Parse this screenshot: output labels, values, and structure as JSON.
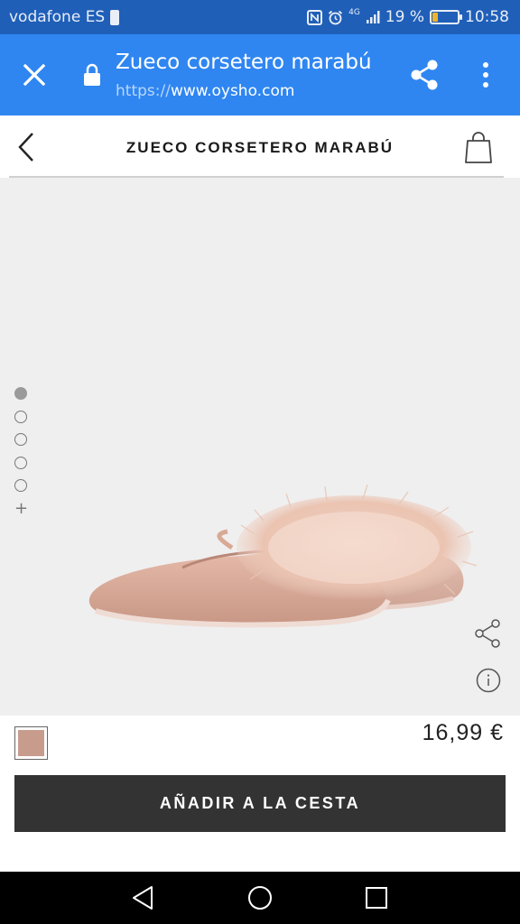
{
  "status_bar": {
    "carrier": "vodafone ES",
    "network_type": "4G",
    "battery_percent": "19 %",
    "battery_level": 0.19,
    "time": "10:58",
    "icons": [
      "sim-icon",
      "nfc-icon",
      "alarm-icon",
      "signal-icon",
      "battery-icon"
    ]
  },
  "browser": {
    "title": "Zueco corsetero marabú",
    "url_scheme": "https://",
    "url_host": "www.oysho.com",
    "accent_color": "#2f86f1",
    "icons": [
      "close-icon",
      "lock-icon",
      "share-icon",
      "more-vert-icon"
    ]
  },
  "header": {
    "title": "ZUECO CORSETERO MARABÚ",
    "icons": [
      "chevron-left-icon",
      "shopping-bag-icon"
    ]
  },
  "gallery": {
    "image_count": 5,
    "active_index": 0,
    "more_symbol": "+",
    "icons": [
      "share-icon",
      "info-icon"
    ]
  },
  "product": {
    "price": "16,99 €",
    "color_swatch": "#c79c8c"
  },
  "cta": {
    "add_to_cart_label": "AÑADIR A LA CESTA"
  },
  "nav": {
    "icons": [
      "nav-back-icon",
      "nav-home-icon",
      "nav-recent-icon"
    ]
  }
}
